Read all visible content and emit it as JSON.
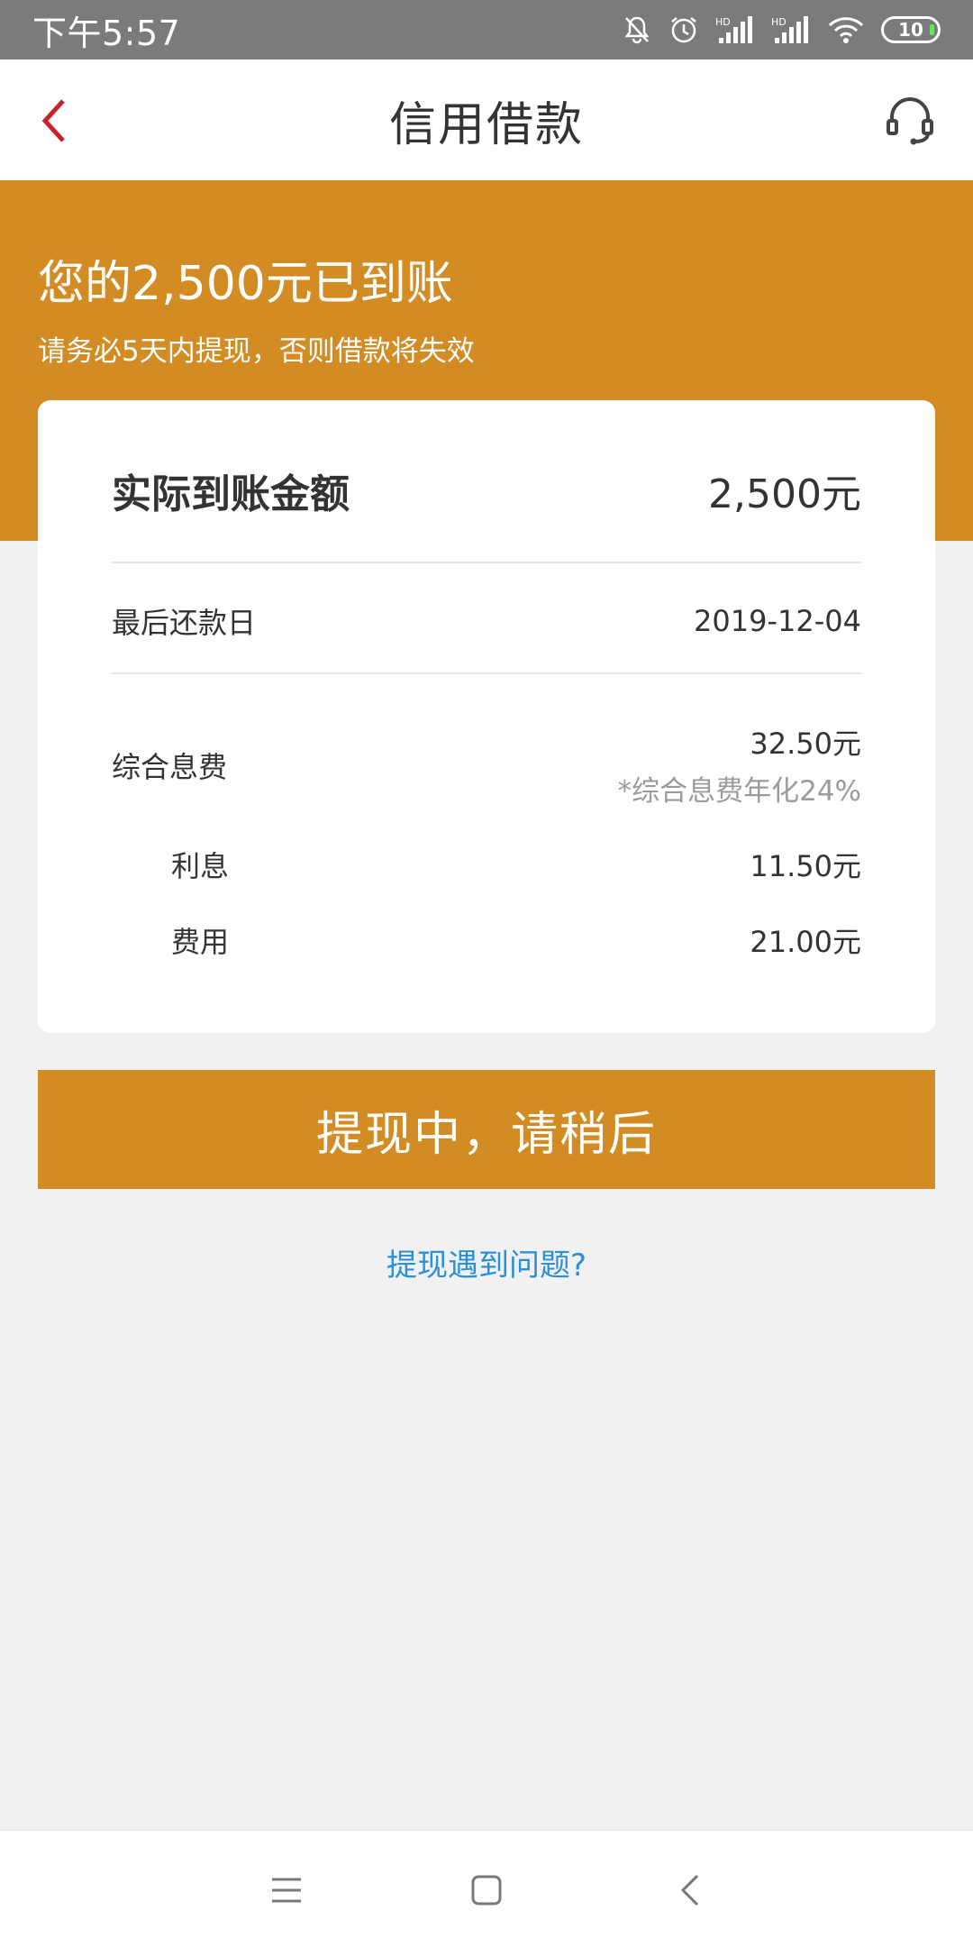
{
  "status_bar": {
    "time": "下午5:57",
    "battery": "10"
  },
  "nav": {
    "title": "信用借款"
  },
  "banner": {
    "title": "您的2,500元已到账",
    "subtitle": "请务必5天内提现，否则借款将失效"
  },
  "card": {
    "amount_label": "实际到账金额",
    "amount_value": "2,500元",
    "due_label": "最后还款日",
    "due_value": "2019-12-04",
    "fee_label": "综合息费",
    "fee_value": "32.50元",
    "fee_note": "*综合息费年化24%",
    "interest_label": "利息",
    "interest_value": "11.50元",
    "cost_label": "费用",
    "cost_value": "21.00元"
  },
  "action": {
    "button_label": "提现中，请稍后"
  },
  "help": {
    "link_text": "提现遇到问题?"
  },
  "colors": {
    "accent": "#d38b24",
    "link": "#2a91d8",
    "back": "#c9202a"
  }
}
